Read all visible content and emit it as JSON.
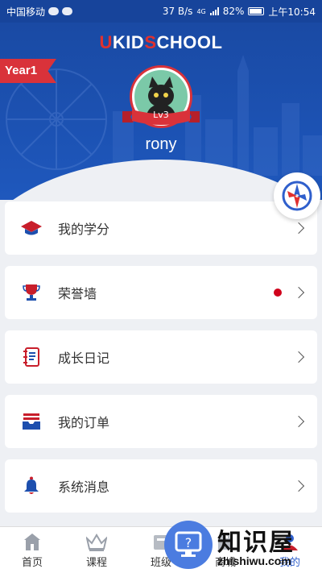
{
  "status_bar": {
    "carrier": "中国移动",
    "speed": "37 B/s",
    "network": "4G",
    "battery": "82%",
    "time": "上午10:54"
  },
  "header": {
    "logo_u": "U",
    "logo_kid": "KID",
    "logo_s": "S",
    "logo_chool": "CHOOL",
    "year_tag": "Year1",
    "level": "Lv3",
    "username": "rony"
  },
  "menu": [
    {
      "label": "我的学分",
      "icon": "graduation-cap-icon",
      "badge": false
    },
    {
      "label": "荣誉墙",
      "icon": "trophy-icon",
      "badge": true
    },
    {
      "label": "成长日记",
      "icon": "notebook-icon",
      "badge": false
    },
    {
      "label": "我的订单",
      "icon": "order-tray-icon",
      "badge": false
    },
    {
      "label": "系统消息",
      "icon": "bell-icon",
      "badge": false
    }
  ],
  "tabs": [
    {
      "label": "首页",
      "icon": "home-icon"
    },
    {
      "label": "课程",
      "icon": "crown-icon"
    },
    {
      "label": "班级",
      "icon": "class-icon"
    },
    {
      "label": "商城",
      "icon": "shop-icon"
    },
    {
      "label": "我的",
      "icon": "profile-icon",
      "active": true
    }
  ],
  "watermark": {
    "text": "知识屋",
    "url": "zhishiwu.com"
  },
  "colors": {
    "brand_blue": "#1c52b3",
    "accent_red": "#d9323a",
    "icon_blue": "#2f5fcc"
  }
}
